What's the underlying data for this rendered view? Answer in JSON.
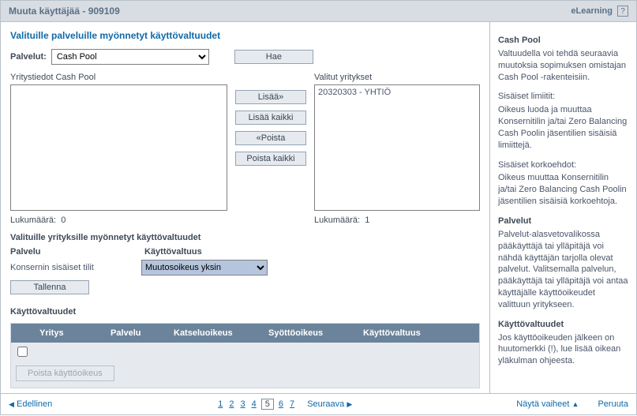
{
  "header": {
    "title": "Muuta käyttäjää - 909109",
    "elearning": "eLearning",
    "help": "?"
  },
  "section_title": "Valituille palveluille myönnetyt käyttövaltuudet",
  "services": {
    "label": "Palvelut:",
    "selected": "Cash Pool",
    "fetch": "Hae"
  },
  "left_list": {
    "label": "Yritystiedot Cash Pool",
    "count_label": "Lukumäärä:",
    "count": "0"
  },
  "right_list": {
    "label": "Valitut yritykset",
    "items": [
      "20320303 - YHTIÖ"
    ],
    "count_label": "Lukumäärä:",
    "count": "1"
  },
  "transfer": {
    "add": "Lisää»",
    "add_all": "Lisää kaikki",
    "remove": "«Poista",
    "remove_all": "Poista kaikki"
  },
  "company_perm": {
    "title": "Valituille yrityksille myönnetyt käyttövaltuudet",
    "service_h": "Palvelu",
    "perm_h": "Käyttövaltuus",
    "service_value": "Konsernin sisäiset tilit",
    "perm_selected": "Muutosoikeus yksin",
    "save": "Tallenna"
  },
  "table": {
    "title": "Käyttövaltuudet",
    "columns": {
      "company": "Yritys",
      "service": "Palvelu",
      "view": "Katseluoikeus",
      "input": "Syöttöoikeus",
      "perm": "Käyttövaltuus"
    },
    "remove_btn": "Poista käyttöoikeus"
  },
  "help": {
    "s1_title": "Cash Pool",
    "s1_body": "Valtuudella voi tehdä seuraavia muutoksia sopimuksen omistajan Cash Pool -rakenteisiin.",
    "s2_title": "Sisäiset limiitit:",
    "s2_body": "Oikeus luoda ja muuttaa Konsernitilin ja/tai Zero Balancing Cash Poolin jäsentilien sisäisiä limiittejä.",
    "s3_title": "Sisäiset korkoehdot:",
    "s3_body": "Oikeus muuttaa Konsernitilin ja/tai Zero Balancing Cash Poolin jäsentilien sisäisiä korkoehtoja.",
    "s4_title": "Palvelut",
    "s4_body": "Palvelut-alasvetovalikossa pääkäyttäjä tai ylläpitäjä voi nähdä käyttäjän tarjolla olevat palvelut. Valitsemalla palvelun, pääkäyttäjä tai ylläpitäjä voi antaa käyttäjälle käyttöoikeudet valittuun yritykseen.",
    "s5_title": "Käyttövaltuudet",
    "s5_body": "Jos käyttöoikeuden jälkeen on huutomerkki (!), lue lisää oikean yläkulman ohjeesta."
  },
  "footer": {
    "prev": "Edellinen",
    "pages": [
      "1",
      "2",
      "3",
      "4",
      "5",
      "6",
      "7"
    ],
    "current_page": "5",
    "next": "Seuraava",
    "show_steps": "Näytä vaiheet",
    "cancel": "Peruuta"
  }
}
